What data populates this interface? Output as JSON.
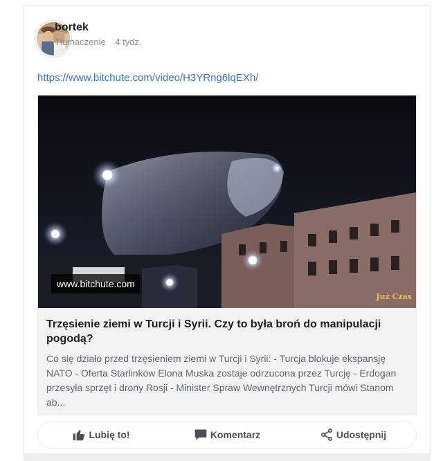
{
  "post": {
    "author": "bortek",
    "translate_label": "Tłumaczenie",
    "time_ago": "4 tydz.",
    "link": "https://www.bitchute.com/video/H3YRng6lqEXh/"
  },
  "preview": {
    "source": "www.bitchute.com",
    "channel_mark": "Już Czas",
    "title": "Trzęsienie ziemi w Turcji i Syrii. Czy to była broń do manipulacji pogodą?",
    "description": "Co się działo przed trzęsieniem ziemi w Turcji i Syrii: - Turcja blokuje ekspansję NATO - Oferta Starlinków Elona Muska zostaje odrzucona przez Turcję - Erdogan przesyła sprzęt i drony Rosji - Minister Spraw Wewnętrznych Turcji mówi Stanom ab..."
  },
  "actions": {
    "like": "Lubię to!",
    "comment": "Komentarz",
    "share": "Udostępnij"
  },
  "icons": {
    "like": "thumbs-up-icon",
    "comment": "speech-bubble-icon",
    "share": "share-icon"
  }
}
